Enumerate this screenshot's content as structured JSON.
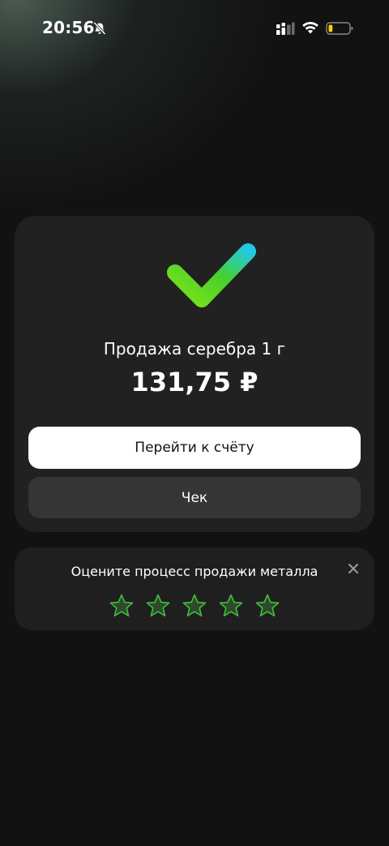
{
  "status_bar": {
    "time": "20:56",
    "icons": [
      "bell-off-icon",
      "signal-icon",
      "wifi-icon",
      "battery-low-icon"
    ],
    "battery_level": 0.2,
    "battery_color": "#f5d000"
  },
  "result": {
    "icon": "success-checkmark-icon",
    "title": "Продажа серебра 1 г",
    "amount": "131,75 ₽",
    "primary_button": "Перейти к счёту",
    "secondary_button": "Чек",
    "accent_gradient": [
      "#7ee21a",
      "#22c9e0"
    ]
  },
  "rating": {
    "title": "Оцените процесс продажи металла",
    "max_stars": 5,
    "selected_stars": 0,
    "star_color": "#3fbf3a",
    "close_icon": "close-icon"
  }
}
